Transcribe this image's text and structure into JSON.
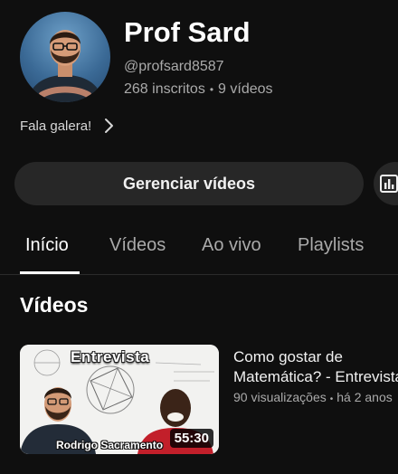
{
  "channel": {
    "name": "Prof Sard",
    "handle": "@profsard8587",
    "subscribers": "268 inscritos",
    "separator": "•",
    "video_count": "9 vídeos",
    "description": "Fala galera!",
    "avatar_icon": "person-avatar"
  },
  "actions": {
    "manage_label": "Gerenciar vídeos",
    "stats_icon": "bar-chart-icon"
  },
  "tabs": [
    {
      "label": "Início",
      "active": true
    },
    {
      "label": "Vídeos",
      "active": false
    },
    {
      "label": "Ao vivo",
      "active": false
    },
    {
      "label": "Playlists",
      "active": false
    }
  ],
  "section": {
    "title": "Vídeos"
  },
  "videos": [
    {
      "thumbnail_banner": "Entrevista",
      "thumbnail_caption": "Rodrigo Sacramento",
      "duration": "55:30",
      "title_line1": "Como gostar de",
      "title_line2": "Matemática? - Entrevista",
      "views": "90 visualizações",
      "separator": "•",
      "age": "há 2 anos"
    }
  ],
  "colors": {
    "background": "#0f0f0f",
    "button_bg": "#272727",
    "text_primary": "#f1f1f1",
    "text_secondary": "#aaaaaa"
  }
}
